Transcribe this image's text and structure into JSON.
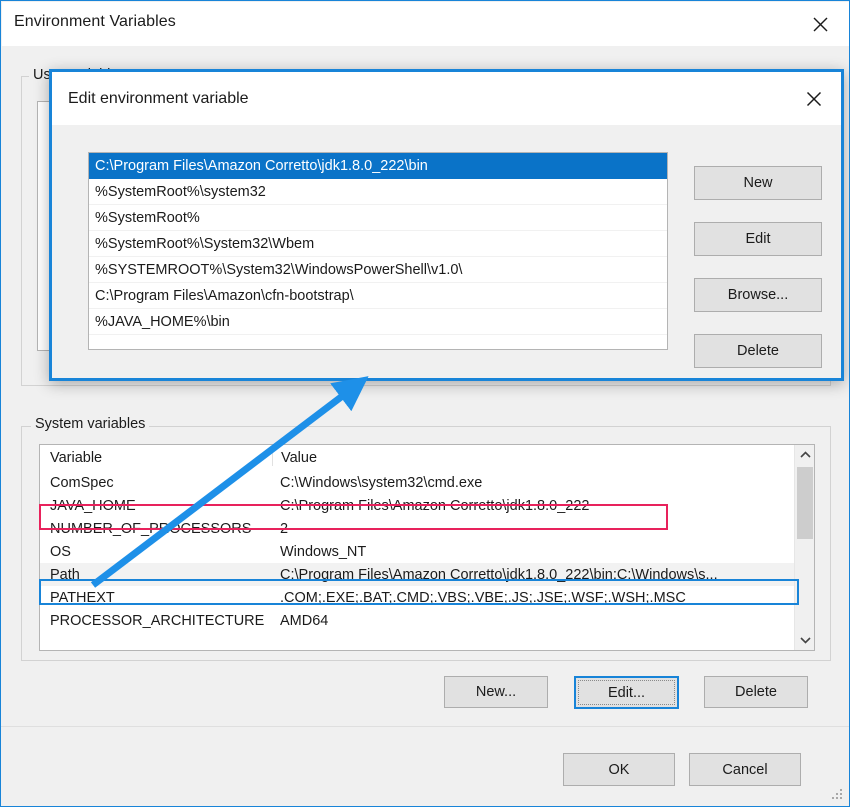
{
  "window": {
    "title": "Environment Variables",
    "close_icon": "close-icon"
  },
  "user_section": {
    "label": "User variables",
    "rows": [
      "",
      "",
      "",
      ""
    ]
  },
  "system_section": {
    "label": "System variables",
    "columns": [
      "Variable",
      "Value"
    ],
    "rows": [
      {
        "variable": "ComSpec",
        "value": "C:\\Windows\\system32\\cmd.exe"
      },
      {
        "variable": "JAVA_HOME",
        "value": "C:\\Program Files\\Amazon Corretto\\jdk1.8.0_222"
      },
      {
        "variable": "NUMBER_OF_PROCESSORS",
        "value": "2"
      },
      {
        "variable": "OS",
        "value": "Windows_NT"
      },
      {
        "variable": "Path",
        "value": "C:\\Program Files\\Amazon Corretto\\jdk1.8.0_222\\bin;C:\\Windows\\s..."
      },
      {
        "variable": "PATHEXT",
        "value": ".COM;.EXE;.BAT;.CMD;.VBS;.VBE;.JS;.JSE;.WSF;.WSH;.MSC"
      },
      {
        "variable": "PROCESSOR_ARCHITECTURE",
        "value": "AMD64"
      }
    ],
    "selected_row_index": 4,
    "scrollbar": {
      "up_icon": "chevron-up-icon",
      "down_icon": "chevron-down-icon"
    }
  },
  "system_buttons": {
    "new": "New...",
    "edit": "Edit...",
    "delete": "Delete"
  },
  "dialog_buttons": {
    "ok": "OK",
    "cancel": "Cancel"
  },
  "edit_dialog": {
    "title": "Edit environment variable",
    "close_icon": "close-icon",
    "items": [
      "C:\\Program Files\\Amazon Corretto\\jdk1.8.0_222\\bin",
      "%SystemRoot%\\system32",
      "%SystemRoot%",
      "%SystemRoot%\\System32\\Wbem",
      "%SYSTEMROOT%\\System32\\WindowsPowerShell\\v1.0\\",
      "C:\\Program Files\\Amazon\\cfn-bootstrap\\",
      "%JAVA_HOME%\\bin"
    ],
    "selected_index": 0,
    "buttons": {
      "new": "New",
      "edit": "Edit",
      "browse": "Browse...",
      "delete": "Delete"
    }
  },
  "annotations": {
    "highlight_java_home_color": "#E8225C",
    "highlight_path_color": "#1884D8",
    "arrow_color": "#1E90E8"
  }
}
